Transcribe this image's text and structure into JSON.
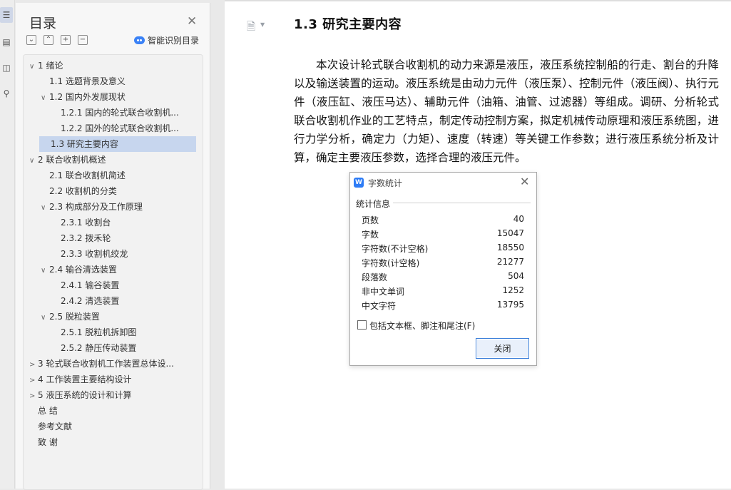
{
  "toc": {
    "title": "目录",
    "smart_label": "智能识别目录",
    "items": [
      {
        "text": "1   绪论",
        "level": 0,
        "caret": "∨",
        "selected": false
      },
      {
        "text": "1.1   选题背景及意义",
        "level": 1,
        "caret": "",
        "selected": false
      },
      {
        "text": "1.2   国内外发展现状",
        "level": 1,
        "caret": "∨",
        "selected": false
      },
      {
        "text": "1.2.1   国内的轮式联合收割机...",
        "level": 2,
        "caret": "",
        "selected": false
      },
      {
        "text": "1.2.2   国外的轮式联合收割机...",
        "level": 2,
        "caret": "",
        "selected": false
      },
      {
        "text": "1.3   研究主要内容",
        "level": 1,
        "caret": "",
        "selected": true
      },
      {
        "text": "2   联合收割机概述",
        "level": 0,
        "caret": "∨",
        "selected": false
      },
      {
        "text": "2.1   联合收割机简述",
        "level": 1,
        "caret": "",
        "selected": false
      },
      {
        "text": "2.2   收割机的分类",
        "level": 1,
        "caret": "",
        "selected": false
      },
      {
        "text": "2.3   构成部分及工作原理",
        "level": 1,
        "caret": "∨",
        "selected": false
      },
      {
        "text": "2.3.1   收割台",
        "level": 2,
        "caret": "",
        "selected": false
      },
      {
        "text": "2.3.2   拨禾轮",
        "level": 2,
        "caret": "",
        "selected": false
      },
      {
        "text": "2.3.3   收割机绞龙",
        "level": 2,
        "caret": "",
        "selected": false
      },
      {
        "text": "2.4   输谷清选装置",
        "level": 1,
        "caret": "∨",
        "selected": false
      },
      {
        "text": "2.4.1   输谷装置",
        "level": 2,
        "caret": "",
        "selected": false
      },
      {
        "text": "2.4.2   清选装置",
        "level": 2,
        "caret": "",
        "selected": false
      },
      {
        "text": "2.5   脱粒装置",
        "level": 1,
        "caret": "∨",
        "selected": false
      },
      {
        "text": "2.5.1   脱粒机拆卸图",
        "level": 2,
        "caret": "",
        "selected": false
      },
      {
        "text": "2.5.2   静压传动装置",
        "level": 2,
        "caret": "",
        "selected": false
      },
      {
        "text": "3   轮式联合收割机工作装置总体设...",
        "level": 0,
        "caret": ">",
        "selected": false
      },
      {
        "text": "4   工作装置主要结构设计",
        "level": 0,
        "caret": ">",
        "selected": false
      },
      {
        "text": "5   液压系统的设计和计算",
        "level": 0,
        "caret": ">",
        "selected": false
      },
      {
        "text": "总  结",
        "level": 0,
        "caret": "",
        "selected": false
      },
      {
        "text": "参考文献",
        "level": 0,
        "caret": "",
        "selected": false
      },
      {
        "text": "致  谢",
        "level": 0,
        "caret": "",
        "selected": false
      }
    ]
  },
  "document": {
    "heading": "1.3   研究主要内容",
    "paragraph": "本次设计轮式联合收割机的动力来源是液压，液压系统控制船的行走、割台的升降以及输送装置的运动。液压系统是由动力元件（液压泵）、控制元件（液压阀）、执行元件（液压缸、液压马达）、辅助元件（油箱、油管、过滤器）等组成。调研、分析轮式联合收割机作业的工艺特点，制定传动控制方案，拟定机械传动原理和液压系统图，进行力学分析，确定力（力矩）、速度（转速）等关键工作参数；进行液压系统分析及计算，确定主要液压参数，选择合理的液压元件。"
  },
  "dialog": {
    "title": "字数统计",
    "group_label": "统计信息",
    "stats": [
      {
        "label": "页数",
        "value": "40"
      },
      {
        "label": "字数",
        "value": "15047"
      },
      {
        "label": "字符数(不计空格)",
        "value": "18550"
      },
      {
        "label": "字符数(计空格)",
        "value": "21277"
      },
      {
        "label": "段落数",
        "value": "504"
      },
      {
        "label": "非中文单词",
        "value": "1252"
      },
      {
        "label": "中文字符",
        "value": "13795"
      }
    ],
    "checkbox_label": "包括文本框、脚注和尾注(F)",
    "checkbox_checked": false,
    "close_button": "关闭"
  }
}
